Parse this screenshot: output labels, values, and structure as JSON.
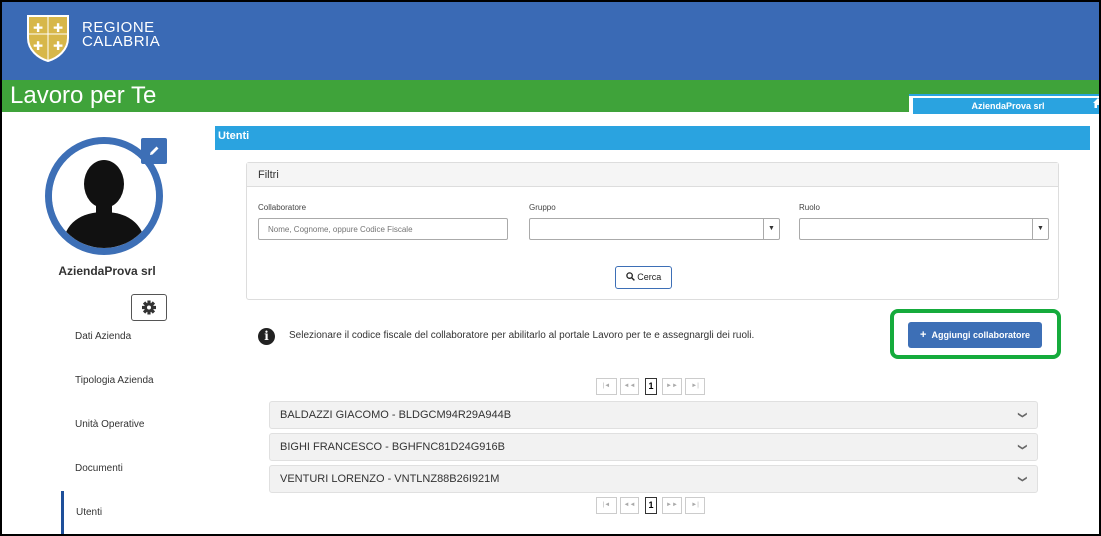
{
  "header": {
    "brand_line1": "REGIONE",
    "brand_line2": "CALABRIA",
    "app_title": "Lavoro per Te",
    "company_tab": "AziendaProva srl"
  },
  "sidebar": {
    "company_name": "AziendaProva srl",
    "items": [
      {
        "label": "Dati Azienda"
      },
      {
        "label": "Tipologia Azienda"
      },
      {
        "label": "Unità Operative"
      },
      {
        "label": "Documenti"
      },
      {
        "label": "Utenti",
        "active": true
      }
    ]
  },
  "main": {
    "panel_title": "Utenti",
    "filters": {
      "title": "Filtri",
      "collaboratore_label": "Collaboratore",
      "collaboratore_placeholder": "Nome, Cognome, oppure Codice Fiscale",
      "gruppo_label": "Gruppo",
      "gruppo_value": "",
      "ruolo_label": "Ruolo",
      "ruolo_value": "",
      "search_label": "Cerca"
    },
    "info_text": "Selezionare il codice fiscale del collaboratore per abilitarlo al portale Lavoro per te e assegnargli dei ruoli.",
    "add_button": "Aggiungi collaboratore",
    "pager": {
      "current": "1",
      "first": "|◄",
      "prev": "◄◄",
      "next": "►►",
      "last": "►|"
    },
    "users": [
      {
        "label": "BALDAZZI GIACOMO - BLDGCM94R29A944B"
      },
      {
        "label": "BIGHI FRANCESCO - BGHFNC81D24G916B"
      },
      {
        "label": "VENTURI LORENZO - VNTLNZ88B26I921M"
      }
    ]
  },
  "colors": {
    "header_blue": "#3a6ab5",
    "green_bar": "#3fa33a",
    "panel_blue": "#2aa3e0",
    "button_blue": "#3d6fb6",
    "highlight_green": "#15ab3c"
  },
  "icons": {
    "logo": "regione-calabria-logo",
    "home": "home-icon",
    "edit": "pencil-icon",
    "settings": "gear-icon",
    "info": "info-icon",
    "search": "search-icon",
    "add": "plus-icon",
    "expand": "chevron-down-icon"
  }
}
